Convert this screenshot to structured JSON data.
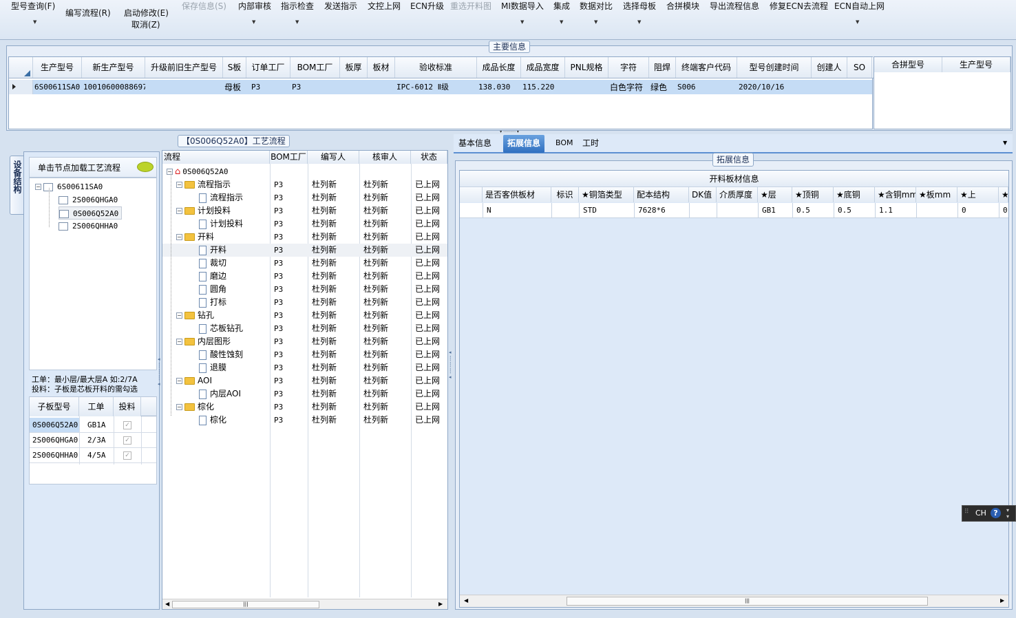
{
  "toolbar": {
    "items": [
      {
        "label": "型号查询(F)",
        "disabled": false
      },
      {
        "label": "编写流程(R)",
        "disabled": false
      },
      {
        "label": "启动修改(E)",
        "disabled": false
      },
      {
        "label": "取消(Z)",
        "disabled": false
      },
      {
        "label": "保存信息(S)",
        "disabled": true
      },
      {
        "label": "内部审核",
        "disabled": false
      },
      {
        "label": "指示检查",
        "disabled": false
      },
      {
        "label": "发送指示",
        "disabled": false
      },
      {
        "label": "文控上网",
        "disabled": false
      },
      {
        "label": "ECN升级",
        "disabled": false
      },
      {
        "label": "重选开料图",
        "disabled": true
      },
      {
        "label": "MI数据导入",
        "disabled": false
      },
      {
        "label": "集成",
        "disabled": false
      },
      {
        "label": "数据对比",
        "disabled": false
      },
      {
        "label": "选择母板",
        "disabled": false
      },
      {
        "label": "合拼模块",
        "disabled": false
      },
      {
        "label": "导出流程信息",
        "disabled": false
      },
      {
        "label": "修复ECN去流程",
        "disabled": false
      },
      {
        "label": "ECN自动上网",
        "disabled": false
      }
    ]
  },
  "main_info": {
    "title": "主要信息",
    "columns": [
      "生产型号",
      "新生产型号",
      "升级前旧生产型号",
      "S板",
      "订单工厂",
      "BOM工厂",
      "板厚",
      "板材",
      "验收标准",
      "成品长度",
      "成品宽度",
      "PNL规格",
      "字符",
      "阻焊",
      "终端客户代码",
      "型号创建时间",
      "创建人",
      "SO"
    ],
    "row": [
      "6S00611SA0",
      "10010600088697",
      "",
      "母板",
      "P3",
      "P3",
      "",
      "",
      "IPC-6012 Ⅱ级",
      "138.030",
      "115.220",
      "",
      "白色字符",
      "绿色",
      "S006",
      "2020/10/16",
      "",
      ""
    ],
    "side_columns": [
      "合拼型号",
      "生产型号"
    ]
  },
  "left_panel": {
    "vertical_tab": "设备结构",
    "load_hint": "单击节点加载工艺流程",
    "tree": [
      "6S00611SA0",
      "2S006QHGA0",
      "0S006Q52A0",
      "2S006QHHA0"
    ],
    "note_line1": "工单：最小层/最大层A 如:2/7A",
    "note_line2": "投料：子板是芯板开料的需勾选",
    "sub_columns": [
      "子板型号",
      "工单",
      "投料"
    ],
    "sub_rows": [
      {
        "model": "0S006Q52A0",
        "order": "GB1A",
        "feed": true
      },
      {
        "model": "2S006QHGA0",
        "order": "2/3A",
        "feed": true
      },
      {
        "model": "2S006QHHA0",
        "order": "4/5A",
        "feed": true
      }
    ]
  },
  "process": {
    "title": "【0S006Q52A0】工艺流程",
    "columns": [
      "流程",
      "BOM工厂",
      "编写人",
      "核审人",
      "状态"
    ],
    "root": "0S006Q52A0",
    "factory": "P3",
    "writer": "杜列新",
    "reviewer": "杜列新",
    "status": "已上网",
    "rows": [
      {
        "name": "流程指示",
        "kind": "folder"
      },
      {
        "name": "流程指示",
        "kind": "doc"
      },
      {
        "name": "计划投料",
        "kind": "folder"
      },
      {
        "name": "计划投料",
        "kind": "doc"
      },
      {
        "name": "开料",
        "kind": "folder"
      },
      {
        "name": "开料",
        "kind": "doc"
      },
      {
        "name": "裁切",
        "kind": "doc"
      },
      {
        "name": "磨边",
        "kind": "doc"
      },
      {
        "name": "圆角",
        "kind": "doc"
      },
      {
        "name": "打标",
        "kind": "doc"
      },
      {
        "name": "钻孔",
        "kind": "folder"
      },
      {
        "name": "芯板钻孔",
        "kind": "doc"
      },
      {
        "name": "内层图形",
        "kind": "folder"
      },
      {
        "name": "酸性蚀刻",
        "kind": "doc"
      },
      {
        "name": "退膜",
        "kind": "doc"
      },
      {
        "name": "AOI",
        "kind": "folder"
      },
      {
        "name": "内层AOI",
        "kind": "doc"
      },
      {
        "name": "棕化",
        "kind": "folder"
      },
      {
        "name": "棕化",
        "kind": "doc"
      }
    ]
  },
  "right_tabs": [
    "基本信息",
    "拓展信息",
    "BOM",
    "工时"
  ],
  "ext_info": {
    "title": "拓展信息",
    "table_title": "开料板材信息",
    "columns": [
      "是否客供板材",
      "标识",
      "★铜箔类型",
      "配本结构",
      "DK值",
      "介质厚度",
      "★层",
      "★顶铜",
      "★底铜",
      "★含铜mm",
      "★板mm",
      "★上",
      "★"
    ],
    "row": [
      "N",
      "",
      "STD",
      "7628*6",
      "",
      "",
      "GB1",
      "0.5",
      "0.5",
      "1.1",
      "",
      "0",
      "0"
    ]
  },
  "ime": {
    "label": "CH",
    "help": "?"
  },
  "colors": {
    "accent": "#2f6fc0",
    "selected_row": "#c5dcf5",
    "panel_bg": "#dde9f8"
  }
}
